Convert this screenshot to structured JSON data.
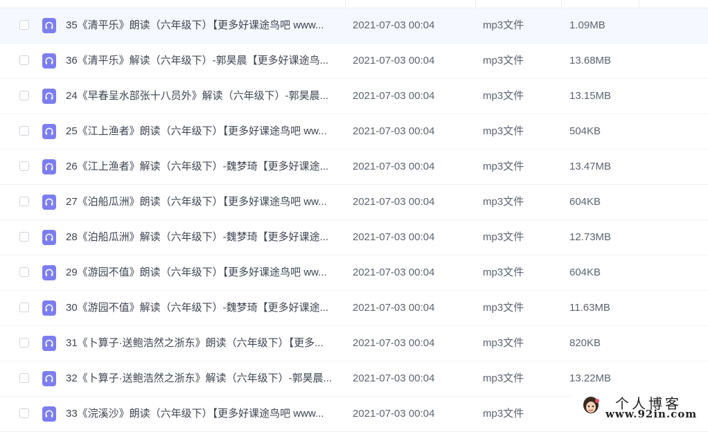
{
  "files": [
    {
      "name": "35《清平乐》朗读（六年级下）【更多好课途鸟吧 www...",
      "date": "2021-07-03 00:04",
      "type": "mp3文件",
      "size": "1.09MB"
    },
    {
      "name": "36《清平乐》解读（六年级下）-郭昊晨【更多好课途鸟...",
      "date": "2021-07-03 00:04",
      "type": "mp3文件",
      "size": "13.68MB"
    },
    {
      "name": "24《早春呈水部张十八员外》解读（六年级下）-郭昊晨...",
      "date": "2021-07-03 00:04",
      "type": "mp3文件",
      "size": "13.15MB"
    },
    {
      "name": "25《江上渔者》朗读（六年级下）【更多好课途鸟吧 ww...",
      "date": "2021-07-03 00:04",
      "type": "mp3文件",
      "size": "504KB"
    },
    {
      "name": "26《江上渔者》解读（六年级下）-魏梦琦【更多好课途...",
      "date": "2021-07-03 00:04",
      "type": "mp3文件",
      "size": "13.47MB"
    },
    {
      "name": "27《泊船瓜洲》朗读（六年级下）【更多好课途鸟吧 ww...",
      "date": "2021-07-03 00:04",
      "type": "mp3文件",
      "size": "604KB"
    },
    {
      "name": "28《泊船瓜洲》解读（六年级下）-魏梦琦【更多好课途...",
      "date": "2021-07-03 00:04",
      "type": "mp3文件",
      "size": "12.73MB"
    },
    {
      "name": "29《游园不值》朗读（六年级下）【更多好课途鸟吧 ww...",
      "date": "2021-07-03 00:04",
      "type": "mp3文件",
      "size": "604KB"
    },
    {
      "name": "30《游园不值》解读（六年级下）-魏梦琦【更多好课途...",
      "date": "2021-07-03 00:04",
      "type": "mp3文件",
      "size": "11.63MB"
    },
    {
      "name": "31《卜算子·送鲍浩然之浙东》朗读（六年级下）【更多...",
      "date": "2021-07-03 00:04",
      "type": "mp3文件",
      "size": "820KB"
    },
    {
      "name": "32《卜算子·送鲍浩然之浙东》解读（六年级下）-郭昊晨...",
      "date": "2021-07-03 00:04",
      "type": "mp3文件",
      "size": "13.22MB"
    },
    {
      "name": "33《浣溪沙》朗读（六年级下）【更多好课途鸟吧 www...",
      "date": "2021-07-03 00:04",
      "type": "mp3文件",
      "size": ""
    }
  ],
  "watermark": {
    "title": "个人博客",
    "url": "www.92in.com"
  },
  "icon": "headphones-icon",
  "accent_color": "#7c7ef0"
}
